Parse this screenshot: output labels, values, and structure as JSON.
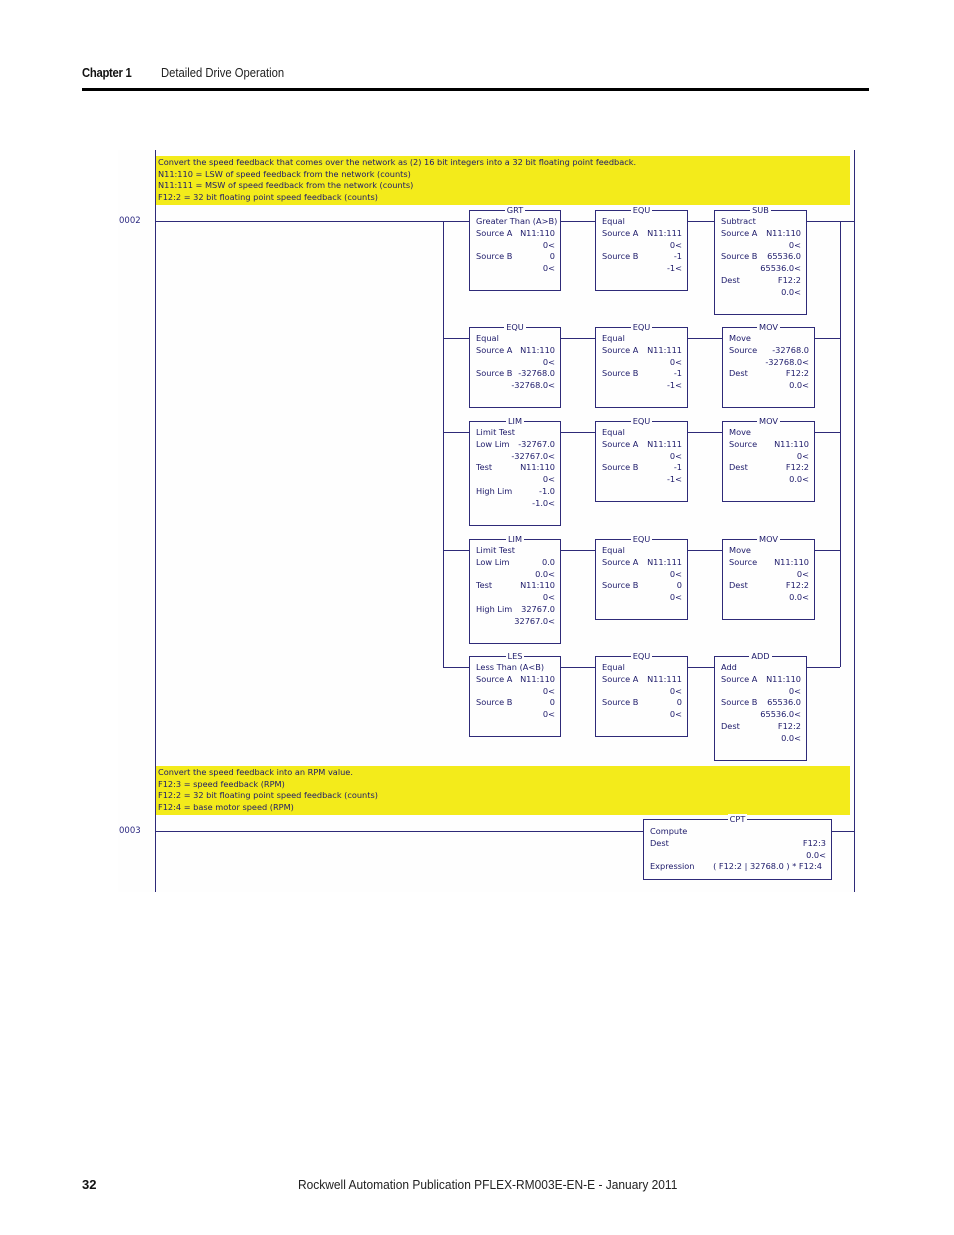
{
  "header": {
    "chapter": "Chapter 1",
    "title": "Detailed Drive Operation"
  },
  "footer": {
    "page_number": "32",
    "publication": "Rockwell Automation Publication PFLEX-RM003E-EN-E - January 2011"
  },
  "ladder": {
    "colors": {
      "comment_bg": "#f3eb1b",
      "wire": "#2e2a78",
      "text": "#1d1a6a"
    },
    "rungs": [
      {
        "number": "0002",
        "comment": [
          "Convert the speed feedback that comes over the network as (2) 16 bit integers into a 32 bit floating point feedback.",
          "N11:110 = LSW of speed feedback from the network (counts)",
          "N11:111 = MSW of speed feedback from the network (counts)",
          "F12:2 = 32 bit floating point speed feedback (counts)"
        ],
        "branches": [
          [
            {
              "mnemonic": "GRT",
              "rows": [
                [
                  "Greater Than (A>B)",
                  ""
                ],
                [
                  "Source A",
                  "N11:110"
                ],
                [
                  "",
                  "0<"
                ],
                [
                  "Source B",
                  "0"
                ],
                [
                  "",
                  "0<"
                ]
              ]
            },
            {
              "mnemonic": "EQU",
              "rows": [
                [
                  "Equal",
                  ""
                ],
                [
                  "Source A",
                  "N11:111"
                ],
                [
                  "",
                  "0<"
                ],
                [
                  "Source B",
                  "-1"
                ],
                [
                  "",
                  "-1<"
                ]
              ]
            },
            {
              "mnemonic": "SUB",
              "rows": [
                [
                  "Subtract",
                  ""
                ],
                [
                  "Source A",
                  "N11:110"
                ],
                [
                  "",
                  "0<"
                ],
                [
                  "Source B",
                  "65536.0"
                ],
                [
                  "",
                  "65536.0<"
                ],
                [
                  "Dest",
                  "F12:2"
                ],
                [
                  "",
                  "0.0<"
                ]
              ]
            }
          ],
          [
            {
              "mnemonic": "EQU",
              "rows": [
                [
                  "Equal",
                  ""
                ],
                [
                  "Source A",
                  "N11:110"
                ],
                [
                  "",
                  "0<"
                ],
                [
                  "Source B",
                  "-32768.0"
                ],
                [
                  "",
                  "-32768.0<"
                ]
              ]
            },
            {
              "mnemonic": "EQU",
              "rows": [
                [
                  "Equal",
                  ""
                ],
                [
                  "Source A",
                  "N11:111"
                ],
                [
                  "",
                  "0<"
                ],
                [
                  "Source B",
                  "-1"
                ],
                [
                  "",
                  "-1<"
                ]
              ]
            },
            {
              "mnemonic": "MOV",
              "rows": [
                [
                  "Move",
                  ""
                ],
                [
                  "Source",
                  "-32768.0"
                ],
                [
                  "",
                  "-32768.0<"
                ],
                [
                  "Dest",
                  "F12:2"
                ],
                [
                  "",
                  "0.0<"
                ]
              ]
            }
          ],
          [
            {
              "mnemonic": "LIM",
              "rows": [
                [
                  "Limit Test",
                  ""
                ],
                [
                  "Low Lim",
                  "-32767.0"
                ],
                [
                  "",
                  "-32767.0<"
                ],
                [
                  "Test",
                  "N11:110"
                ],
                [
                  "",
                  "0<"
                ],
                [
                  "High Lim",
                  "-1.0"
                ],
                [
                  "",
                  "-1.0<"
                ]
              ]
            },
            {
              "mnemonic": "EQU",
              "rows": [
                [
                  "Equal",
                  ""
                ],
                [
                  "Source A",
                  "N11:111"
                ],
                [
                  "",
                  "0<"
                ],
                [
                  "Source B",
                  "-1"
                ],
                [
                  "",
                  "-1<"
                ]
              ]
            },
            {
              "mnemonic": "MOV",
              "rows": [
                [
                  "Move",
                  ""
                ],
                [
                  "Source",
                  "N11:110"
                ],
                [
                  "",
                  "0<"
                ],
                [
                  "Dest",
                  "F12:2"
                ],
                [
                  "",
                  "0.0<"
                ]
              ]
            }
          ],
          [
            {
              "mnemonic": "LIM",
              "rows": [
                [
                  "Limit Test",
                  ""
                ],
                [
                  "Low Lim",
                  "0.0"
                ],
                [
                  "",
                  "0.0<"
                ],
                [
                  "Test",
                  "N11:110"
                ],
                [
                  "",
                  "0<"
                ],
                [
                  "High Lim",
                  "32767.0"
                ],
                [
                  "",
                  "32767.0<"
                ]
              ]
            },
            {
              "mnemonic": "EQU",
              "rows": [
                [
                  "Equal",
                  ""
                ],
                [
                  "Source A",
                  "N11:111"
                ],
                [
                  "",
                  "0<"
                ],
                [
                  "Source B",
                  "0"
                ],
                [
                  "",
                  "0<"
                ]
              ]
            },
            {
              "mnemonic": "MOV",
              "rows": [
                [
                  "Move",
                  ""
                ],
                [
                  "Source",
                  "N11:110"
                ],
                [
                  "",
                  "0<"
                ],
                [
                  "Dest",
                  "F12:2"
                ],
                [
                  "",
                  "0.0<"
                ]
              ]
            }
          ],
          [
            {
              "mnemonic": "LES",
              "rows": [
                [
                  "Less Than (A<B)",
                  ""
                ],
                [
                  "Source A",
                  "N11:110"
                ],
                [
                  "",
                  "0<"
                ],
                [
                  "Source B",
                  "0"
                ],
                [
                  "",
                  "0<"
                ]
              ]
            },
            {
              "mnemonic": "EQU",
              "rows": [
                [
                  "Equal",
                  ""
                ],
                [
                  "Source A",
                  "N11:111"
                ],
                [
                  "",
                  "0<"
                ],
                [
                  "Source B",
                  "0"
                ],
                [
                  "",
                  "0<"
                ]
              ]
            },
            {
              "mnemonic": "ADD",
              "rows": [
                [
                  "Add",
                  ""
                ],
                [
                  "Source A",
                  "N11:110"
                ],
                [
                  "",
                  "0<"
                ],
                [
                  "Source B",
                  "65536.0"
                ],
                [
                  "",
                  "65536.0<"
                ],
                [
                  "Dest",
                  "F12:2"
                ],
                [
                  "",
                  "0.0<"
                ]
              ]
            }
          ]
        ]
      },
      {
        "number": "0003",
        "comment": [
          "Convert the speed feedback into an RPM value.",
          "F12:3 = speed feedback (RPM)",
          "F12:2 = 32 bit floating point speed feedback (counts)",
          "F12:4 = base motor speed (RPM)"
        ],
        "block": {
          "mnemonic": "CPT",
          "rows": [
            [
              "Compute",
              ""
            ],
            [
              "Dest",
              "F12:3"
            ],
            [
              "",
              "0.0<"
            ],
            [
              "Expression",
              "( F12:2 | 32768.0 ) * F12:4"
            ]
          ]
        }
      }
    ]
  }
}
